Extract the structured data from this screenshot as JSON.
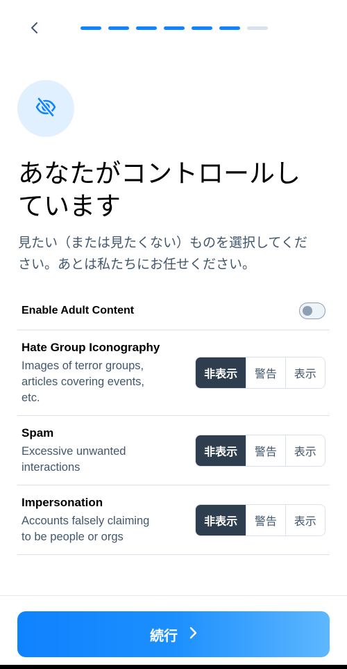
{
  "header": {
    "back_icon": "chevron-left-icon",
    "progress_total": 7,
    "progress_completed": 6
  },
  "hero": {
    "icon": "eye-slash-icon",
    "title_line1": "あなたがコントロールし",
    "title_line2": "ています",
    "subtitle_line1": "見たい（または見たくない）ものを選択してくだ",
    "subtitle_line2": "さい。あとは私たちにお任せください。"
  },
  "adult": {
    "label": "Enable Adult Content",
    "enabled": false
  },
  "options": {
    "hide": "非表示",
    "warn": "警告",
    "show": "表示"
  },
  "categories": [
    {
      "name": "Hate Group Iconography",
      "desc_lines": [
        "Images of terror groups,",
        "articles covering events,",
        "etc."
      ],
      "selected": "hide"
    },
    {
      "name": "Spam",
      "desc_lines": [
        "Excessive unwanted",
        "interactions"
      ],
      "selected": "hide"
    },
    {
      "name": "Impersonation",
      "desc_lines": [
        "Accounts falsely claiming",
        "to be people or orgs"
      ],
      "selected": "hide"
    }
  ],
  "footer": {
    "continue_label": "続行",
    "continue_icon": "chevron-right-icon"
  },
  "colors": {
    "accent": "#1083fe",
    "active_segment": "#2f3e4e",
    "muted_text": "#42576c",
    "hero_bg": "#e1f0ff"
  }
}
